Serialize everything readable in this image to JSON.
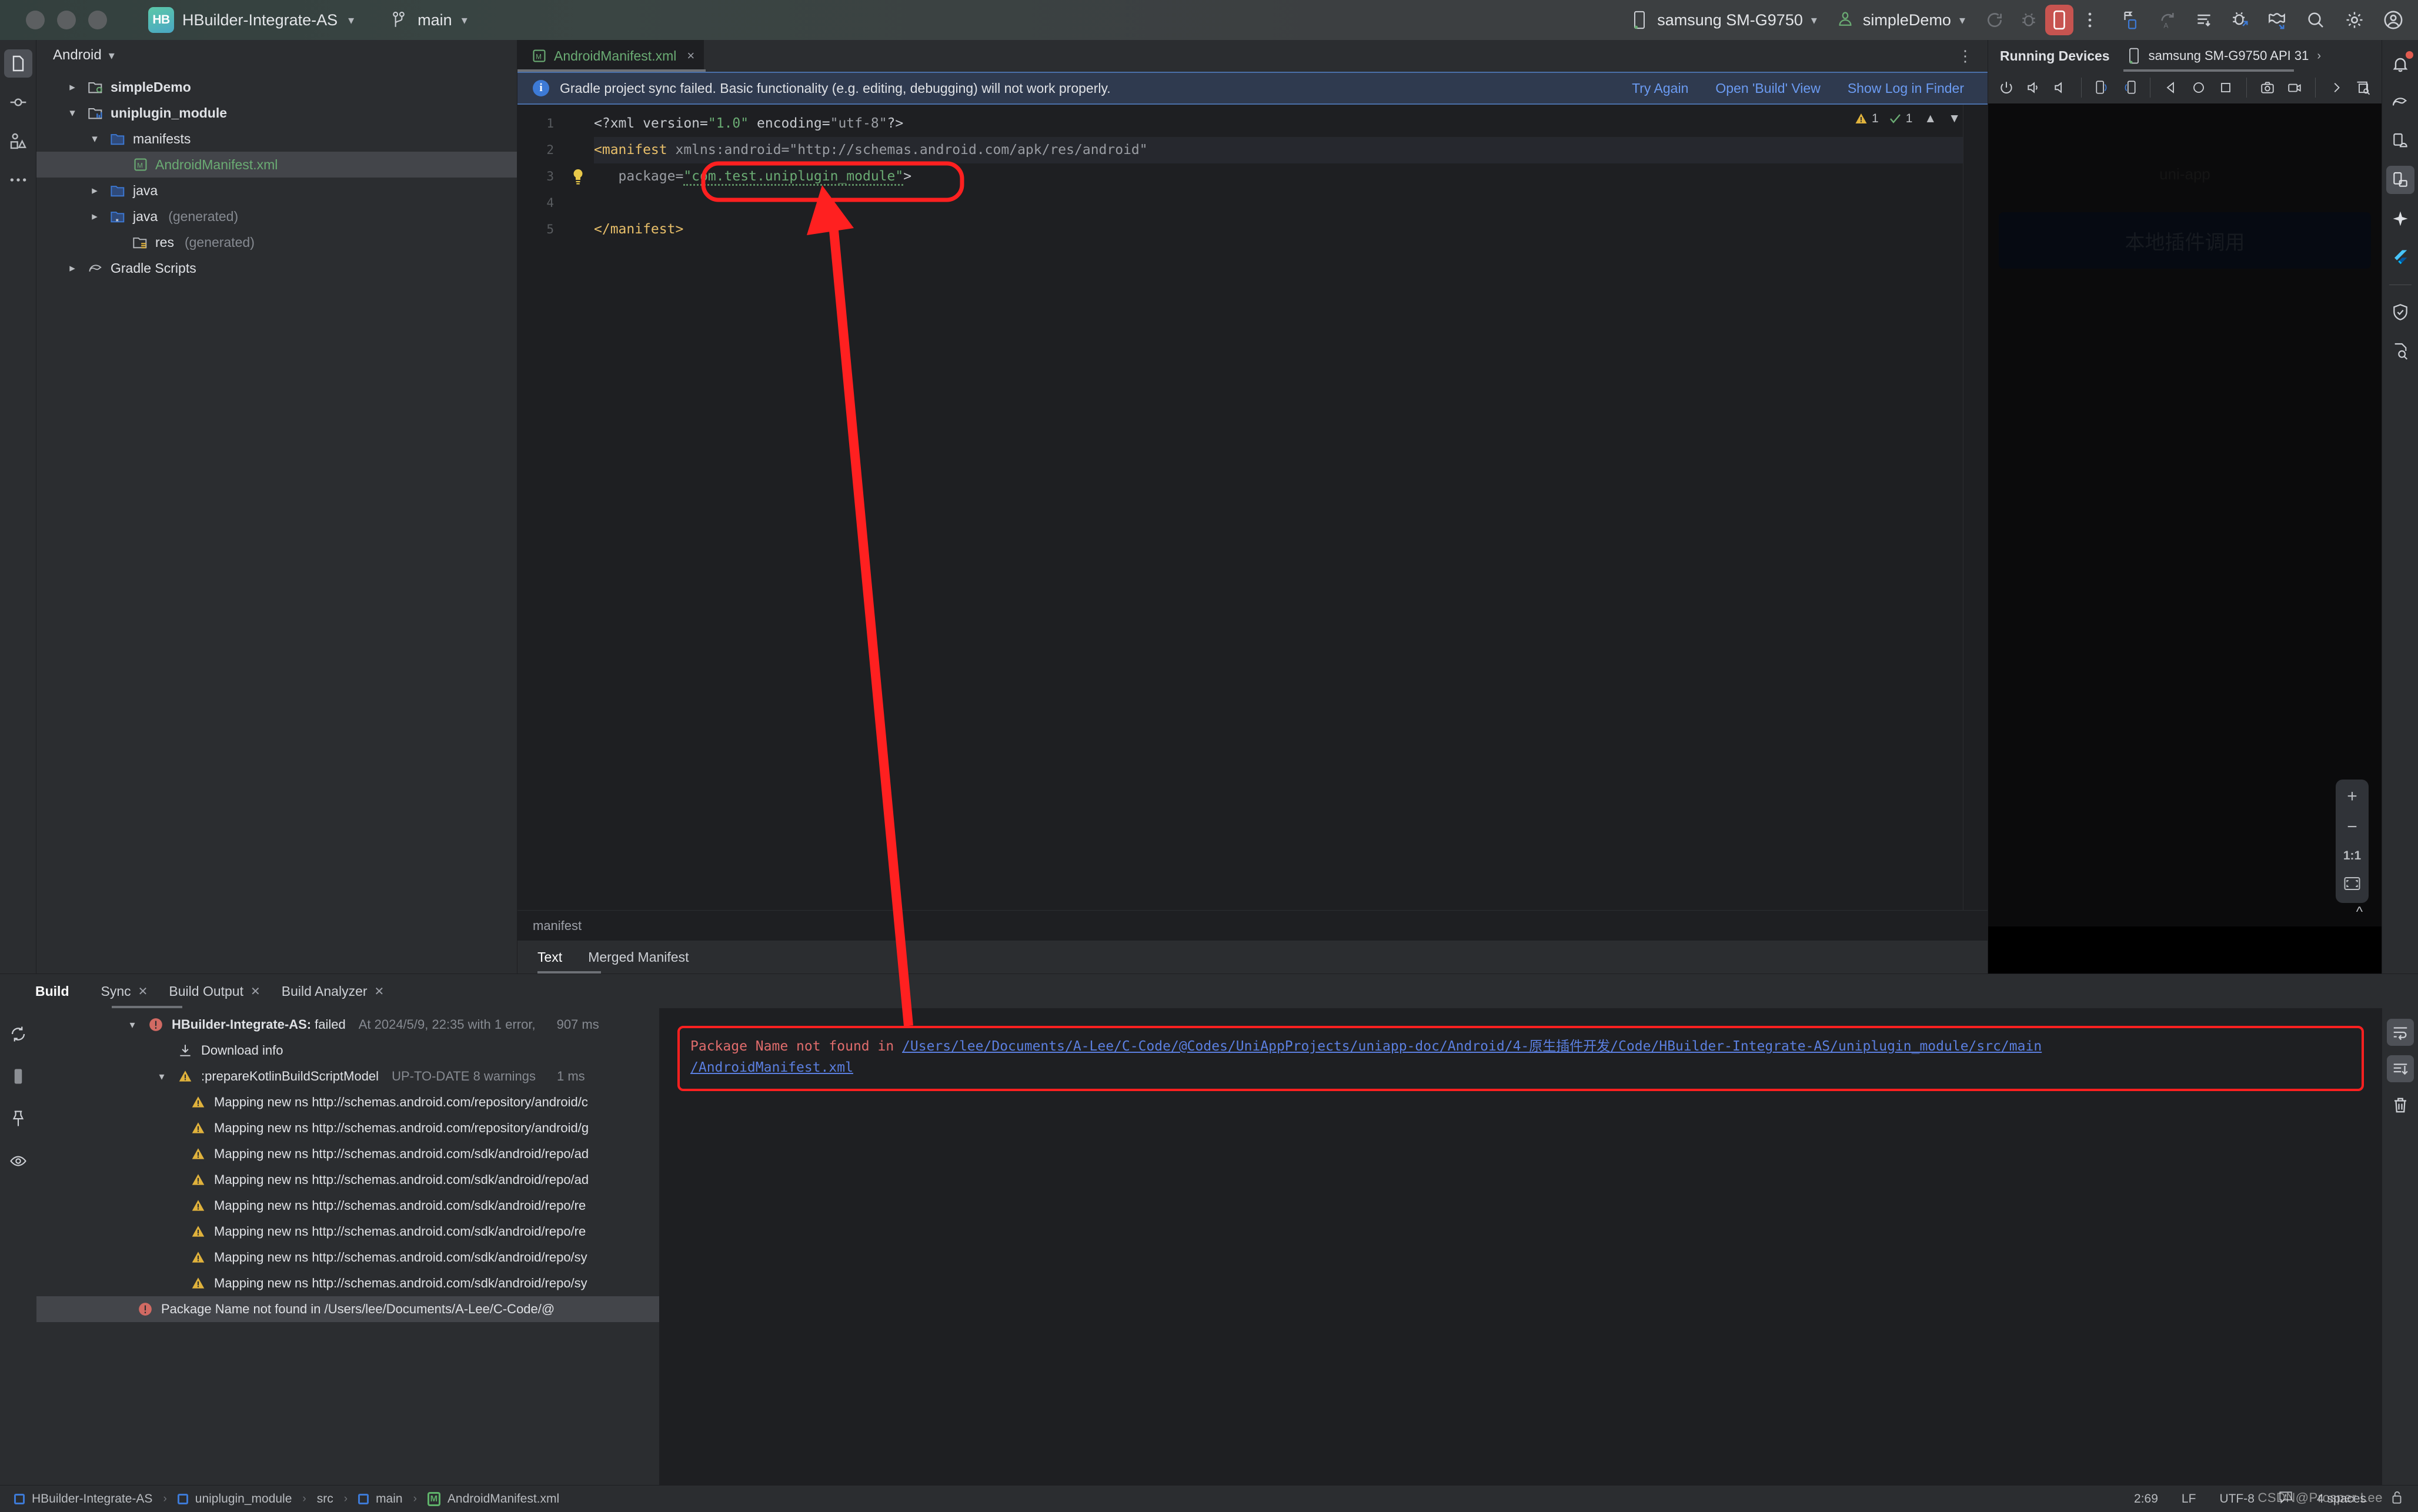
{
  "titlebar": {
    "project_badge": "HB",
    "project_name": "HBuilder-Integrate-AS",
    "branch": "main",
    "device": "samsung SM-G9750",
    "run_config": "simpleDemo",
    "icons": [
      "rerun-icon",
      "debug-icon",
      "stop-icon",
      "more-vertical-icon",
      "device-manager-icon",
      "redo-icon",
      "gradle-sync-icon",
      "debug-attach-icon",
      "avd-manager-icon",
      "search-icon",
      "settings-icon",
      "account-icon"
    ]
  },
  "left_rail": {
    "items": [
      {
        "name": "project-tool-window",
        "icon": "folder-icon",
        "active": true
      },
      {
        "name": "commit-tool-window",
        "icon": "commit-icon",
        "active": false
      },
      {
        "name": "resource-manager-tool-window",
        "icon": "resource-manager-icon",
        "active": false
      },
      {
        "name": "more-tool-windows",
        "icon": "ellipsis-icon",
        "active": false
      }
    ],
    "bottom_items": [
      {
        "name": "build-tool-window",
        "icon": "hammer-icon",
        "active": true
      },
      {
        "name": "run-tool-window",
        "icon": "play-icon",
        "active": false
      },
      {
        "name": "profiler-tool-window",
        "icon": "diamond-icon",
        "active": false
      },
      {
        "name": "logcat-tool-window",
        "icon": "cat-icon",
        "active": false
      },
      {
        "name": "problems-tool-window",
        "icon": "exclamation-circle-icon",
        "active": false
      },
      {
        "name": "terminal-tool-window",
        "icon": "terminal-icon",
        "active": false
      },
      {
        "name": "git-tool-window",
        "icon": "git-branch-icon",
        "active": false
      }
    ]
  },
  "project": {
    "view_selector": "Android",
    "tree": [
      {
        "label": "simpleDemo",
        "indent": 0,
        "arrow": "collapsed",
        "icon": "module-icon",
        "bold": true,
        "selected": false,
        "suffix": ""
      },
      {
        "label": "uniplugin_module",
        "indent": 0,
        "arrow": "expanded",
        "icon": "library-module-icon",
        "bold": true,
        "selected": false,
        "suffix": ""
      },
      {
        "label": "manifests",
        "indent": 1,
        "arrow": "expanded",
        "icon": "folder-blue-icon",
        "bold": false,
        "selected": false,
        "suffix": ""
      },
      {
        "label": "AndroidManifest.xml",
        "indent": 2,
        "arrow": "none",
        "icon": "manifest-file-icon",
        "bold": false,
        "selected": true,
        "suffix": ""
      },
      {
        "label": "java",
        "indent": 1,
        "arrow": "collapsed",
        "icon": "folder-blue-icon",
        "bold": false,
        "selected": false,
        "suffix": ""
      },
      {
        "label": "java",
        "indent": 1,
        "arrow": "collapsed",
        "icon": "folder-generated-icon",
        "bold": false,
        "selected": false,
        "suffix": "(generated)"
      },
      {
        "label": "res",
        "indent": 1,
        "arrow": "none",
        "icon": "folder-res-icon",
        "bold": false,
        "selected": false,
        "suffix": "(generated)"
      },
      {
        "label": "Gradle Scripts",
        "indent": 0,
        "arrow": "collapsed",
        "icon": "gradle-icon",
        "bold": false,
        "selected": false,
        "suffix": ""
      }
    ]
  },
  "editor": {
    "tab": {
      "name": "AndroidManifest.xml",
      "close": "×"
    },
    "notification": {
      "message": "Gradle project sync failed. Basic functionality (e.g. editing, debugging) will not work properly.",
      "actions": [
        "Try Again",
        "Open 'Build' View",
        "Show Log in Finder"
      ]
    },
    "inspections": {
      "warnings": "1",
      "checks": "1"
    },
    "line_numbers": [
      "1",
      "2",
      "3",
      "4",
      "5"
    ],
    "code": {
      "line1_a": "<?xml version=",
      "line1_b": "\"1.0\"",
      "line1_c": " encoding=",
      "line1_d": "\"utf-8\"",
      "line1_e": "?>",
      "line2_a": "<manifest",
      "line2_b": " xmlns:android=",
      "line2_c": "\"http://schemas.android.com/apk/res/android\"",
      "line3_a": "package=",
      "line3_b": "\"com.test.uniplugin_module\"",
      "line3_c": ">",
      "line5_a": "</manifest>"
    },
    "breadcrumb": "manifest",
    "view_tabs": [
      {
        "label": "Text",
        "active": true
      },
      {
        "label": "Merged Manifest",
        "active": false
      }
    ]
  },
  "running_devices": {
    "title": "Running Devices",
    "device_tab": "samsung SM-G9750 API 31",
    "toolbar_icons": [
      "power-icon",
      "volume-up-icon",
      "volume-down-icon",
      "rotate-left-icon",
      "rotate-right-icon",
      "back-icon",
      "home-icon",
      "overview-icon",
      "screenshot-icon",
      "record-icon",
      "more-chevron-icon",
      "device-frame-icon"
    ],
    "screen": {
      "app_title": "uni-app",
      "button_label": "本地插件调用"
    },
    "zoom_controls": {
      "zoom_in": "+",
      "zoom_out": "−",
      "actual_size": "1:1",
      "fit": "fit-icon"
    }
  },
  "right_rail": {
    "items": [
      {
        "name": "notifications",
        "icon": "bell-icon",
        "badge": true,
        "active": false
      },
      {
        "name": "gradle-tool-window",
        "icon": "gradle-elephant-icon",
        "badge": false,
        "active": false
      },
      {
        "name": "device-manager",
        "icon": "device-manager-icon",
        "badge": false,
        "active": false
      },
      {
        "name": "running-devices",
        "icon": "running-devices-icon",
        "badge": false,
        "active": true
      },
      {
        "name": "gemini-assistant",
        "icon": "sparkle-icon",
        "badge": false,
        "active": false
      },
      {
        "name": "flutter-tool-window",
        "icon": "flutter-icon",
        "badge": false,
        "active": false
      },
      {
        "name": "app-quality-insights",
        "icon": "shield-check-icon",
        "badge": false,
        "active": false
      },
      {
        "name": "layout-inspector",
        "icon": "layout-inspector-icon",
        "badge": false,
        "active": false
      }
    ]
  },
  "build_panel": {
    "title": "Build",
    "tabs": [
      {
        "label": "Sync",
        "closable": true,
        "active": true
      },
      {
        "label": "Build Output",
        "closable": true,
        "active": false
      },
      {
        "label": "Build Analyzer",
        "closable": true,
        "active": false
      }
    ],
    "side_tools": [
      "restart-icon",
      "stop-icon",
      "pin-icon",
      "eye-icon"
    ],
    "tree": [
      {
        "indent": 1,
        "arrow": "expanded",
        "icon": "error-icon",
        "text": "HBuilder-Integrate-AS:",
        "bold": true,
        "text2": " failed",
        "dim": "At 2024/5/9, 22:35 with 1 error,",
        "time": "907 ms",
        "selected": false
      },
      {
        "indent": 2,
        "arrow": "none",
        "icon": "download-icon",
        "text": "Download info",
        "bold": false,
        "text2": "",
        "dim": "",
        "time": "",
        "selected": false
      },
      {
        "indent": 2,
        "arrow": "expanded",
        "icon": "warning-icon",
        "text": ":prepareKotlinBuildScriptModel",
        "bold": false,
        "text2": "",
        "dim": "UP-TO-DATE 8 warnings",
        "time": "1 ms",
        "selected": false
      },
      {
        "indent": 3,
        "arrow": "none",
        "icon": "warning-icon",
        "text": "Mapping new ns http://schemas.android.com/repository/android/c",
        "bold": false,
        "text2": "",
        "dim": "",
        "time": "",
        "selected": false
      },
      {
        "indent": 3,
        "arrow": "none",
        "icon": "warning-icon",
        "text": "Mapping new ns http://schemas.android.com/repository/android/g",
        "bold": false,
        "text2": "",
        "dim": "",
        "time": "",
        "selected": false
      },
      {
        "indent": 3,
        "arrow": "none",
        "icon": "warning-icon",
        "text": "Mapping new ns http://schemas.android.com/sdk/android/repo/ad",
        "bold": false,
        "text2": "",
        "dim": "",
        "time": "",
        "selected": false
      },
      {
        "indent": 3,
        "arrow": "none",
        "icon": "warning-icon",
        "text": "Mapping new ns http://schemas.android.com/sdk/android/repo/ad",
        "bold": false,
        "text2": "",
        "dim": "",
        "time": "",
        "selected": false
      },
      {
        "indent": 3,
        "arrow": "none",
        "icon": "warning-icon",
        "text": "Mapping new ns http://schemas.android.com/sdk/android/repo/re",
        "bold": false,
        "text2": "",
        "dim": "",
        "time": "",
        "selected": false
      },
      {
        "indent": 3,
        "arrow": "none",
        "icon": "warning-icon",
        "text": "Mapping new ns http://schemas.android.com/sdk/android/repo/re",
        "bold": false,
        "text2": "",
        "dim": "",
        "time": "",
        "selected": false
      },
      {
        "indent": 3,
        "arrow": "none",
        "icon": "warning-icon",
        "text": "Mapping new ns http://schemas.android.com/sdk/android/repo/sy",
        "bold": false,
        "text2": "",
        "dim": "",
        "time": "",
        "selected": false
      },
      {
        "indent": 3,
        "arrow": "none",
        "icon": "warning-icon",
        "text": "Mapping new ns http://schemas.android.com/sdk/android/repo/sy",
        "bold": false,
        "text2": "",
        "dim": "",
        "time": "",
        "selected": false
      },
      {
        "indent": 4,
        "arrow": "none",
        "icon": "error-icon",
        "text": "Package Name not found in /Users/lee/Documents/A-Lee/C-Code/@",
        "bold": false,
        "text2": "",
        "dim": "",
        "time": "",
        "selected": true
      }
    ],
    "detail": {
      "prefix": "Package Name not found in ",
      "link_line1": "/Users/lee/Documents/A-Lee/C-Code/@Codes/UniAppProjects/uniapp-doc/Android/4-原生插件开发/Code/HBuilder-Integrate-AS/uniplugin_module/src/main",
      "link_line2": "/AndroidManifest.xml"
    },
    "right_tools": [
      "soft-wrap-icon",
      "scroll-to-end-icon",
      "trash-icon"
    ]
  },
  "statusbar": {
    "breadcrumb": [
      {
        "label": "HBuilder-Integrate-AS",
        "icon": "module-icon"
      },
      {
        "label": "uniplugin_module",
        "icon": "module-icon"
      },
      {
        "label": "src",
        "icon": ""
      },
      {
        "label": "main",
        "icon": "module-icon"
      },
      {
        "label": "AndroidManifest.xml",
        "icon": "manifest-file-icon"
      }
    ],
    "caret_position": "2:69",
    "line_separator": "LF",
    "encoding": "UTF-8",
    "indent": "4 spaces",
    "watermark": "CSDN@Prosper Lee"
  },
  "colors": {
    "accent_blue": "#3d7ad6",
    "link_blue": "#6b9bf2",
    "error_red": "#ff2020",
    "warning_yellow": "#e0b23c",
    "string_green": "#6aab73",
    "tag_orange": "#e8bf6a",
    "panel_bg": "#2b2d30",
    "editor_bg": "#1e1f22"
  }
}
